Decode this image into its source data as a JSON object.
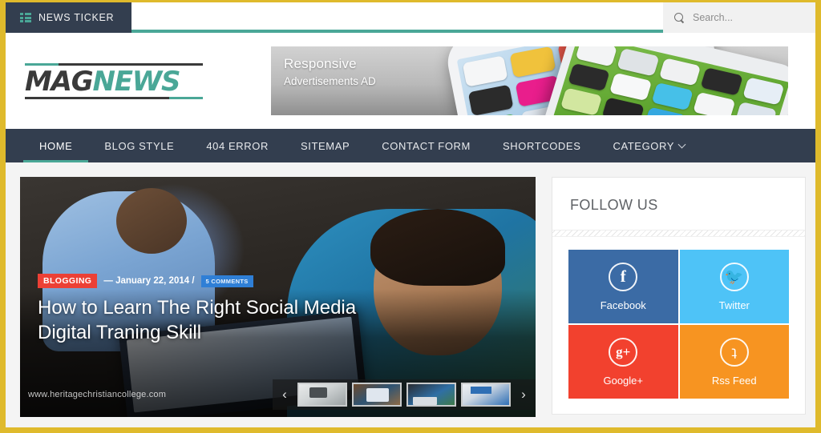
{
  "theme": {
    "frame_color": "#dfba2c",
    "accent_teal": "#4aa797",
    "nav_bg": "#333e4f"
  },
  "topbar": {
    "ticker_label": "NEWS TICKER",
    "ticker_icon": "grid-list-icon",
    "search_placeholder": "Search...",
    "search_value": "",
    "search_icon": "search-icon"
  },
  "header": {
    "logo_mag": "MAG",
    "logo_news": "NEWS",
    "ad": {
      "line1": "Responsive",
      "line2": "Advertisements AD"
    }
  },
  "nav": {
    "items": [
      {
        "label": "HOME",
        "active": true,
        "caret": false
      },
      {
        "label": "BLOG STYLE",
        "active": false,
        "caret": false
      },
      {
        "label": "404 ERROR",
        "active": false,
        "caret": false
      },
      {
        "label": "SITEMAP",
        "active": false,
        "caret": false
      },
      {
        "label": "CONTACT FORM",
        "active": false,
        "caret": false
      },
      {
        "label": "SHORTCODES",
        "active": false,
        "caret": false
      },
      {
        "label": "CATEGORY",
        "active": false,
        "caret": true
      }
    ]
  },
  "slider": {
    "category": "BLOGGING",
    "date": "— January 22, 2014 /",
    "comments": "5 COMMENTS",
    "title": "How to Learn The Right Social Media Digital Traning Skill",
    "watermark": "www.heritagechristiancollege.com",
    "prev_icon": "chevron-left-icon",
    "next_icon": "chevron-right-icon",
    "prev_glyph": "‹",
    "next_glyph": "›",
    "thumbs": [
      {
        "name": "thumb-1"
      },
      {
        "name": "thumb-2"
      },
      {
        "name": "thumb-3"
      },
      {
        "name": "thumb-4"
      }
    ]
  },
  "sidebar": {
    "widget_title": "FOLLOW US",
    "social": [
      {
        "label": "Facebook",
        "glyph": "f",
        "color": "#3b6ba5",
        "icon": "facebook-icon"
      },
      {
        "label": "Twitter",
        "glyph": "🐦",
        "color": "#4ec3f7",
        "icon": "twitter-icon"
      },
      {
        "label": "Google+",
        "glyph": "g+",
        "color": "#f2412e",
        "icon": "googleplus-icon"
      },
      {
        "label": "Rss Feed",
        "glyph": "ʇ",
        "color": "#f79421",
        "icon": "rss-icon"
      }
    ]
  }
}
